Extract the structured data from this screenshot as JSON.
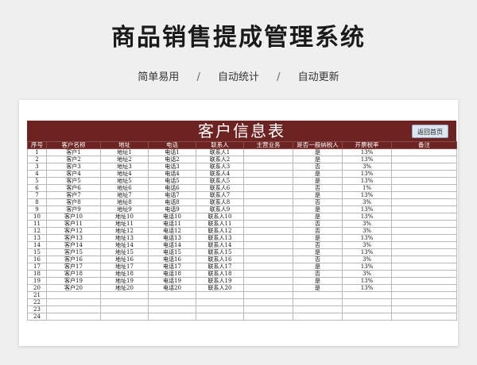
{
  "hero": {
    "title": "商品销售提成管理系统",
    "features": [
      "简单易用",
      "自动统计",
      "自动更新"
    ],
    "separator": "/"
  },
  "sheet": {
    "title": "客户信息表",
    "home_button": "返回首页",
    "columns": [
      "序号",
      "客户名称",
      "地址",
      "电话",
      "联系人",
      "主营业务",
      "是否一般纳税人",
      "开票税率",
      "备注"
    ],
    "rows": [
      [
        "1",
        "客户1",
        "地址1",
        "电话1",
        "联系人1",
        "",
        "是",
        "13%",
        ""
      ],
      [
        "2",
        "客户2",
        "地址2",
        "电话2",
        "联系人2",
        "",
        "是",
        "13%",
        ""
      ],
      [
        "3",
        "客户3",
        "地址3",
        "电话3",
        "联系人3",
        "",
        "否",
        "3%",
        ""
      ],
      [
        "4",
        "客户4",
        "地址4",
        "电话4",
        "联系人4",
        "",
        "是",
        "13%",
        ""
      ],
      [
        "5",
        "客户5",
        "地址5",
        "电话5",
        "联系人5",
        "",
        "是",
        "13%",
        ""
      ],
      [
        "6",
        "客户6",
        "地址6",
        "电话6",
        "联系人6",
        "",
        "否",
        "1%",
        ""
      ],
      [
        "7",
        "客户7",
        "地址7",
        "电话7",
        "联系人7",
        "",
        "是",
        "13%",
        ""
      ],
      [
        "8",
        "客户8",
        "地址8",
        "电话8",
        "联系人8",
        "",
        "否",
        "3%",
        ""
      ],
      [
        "9",
        "客户9",
        "地址9",
        "电话9",
        "联系人9",
        "",
        "是",
        "13%",
        ""
      ],
      [
        "10",
        "客户10",
        "地址10",
        "电话10",
        "联系人10",
        "",
        "是",
        "13%",
        ""
      ],
      [
        "11",
        "客户11",
        "地址11",
        "电话11",
        "联系人11",
        "",
        "否",
        "3%",
        ""
      ],
      [
        "12",
        "客户12",
        "地址12",
        "电话12",
        "联系人12",
        "",
        "否",
        "3%",
        ""
      ],
      [
        "13",
        "客户13",
        "地址13",
        "电话13",
        "联系人13",
        "",
        "是",
        "13%",
        ""
      ],
      [
        "14",
        "客户14",
        "地址14",
        "电话14",
        "联系人14",
        "",
        "否",
        "3%",
        ""
      ],
      [
        "15",
        "客户15",
        "地址15",
        "电话15",
        "联系人15",
        "",
        "是",
        "13%",
        ""
      ],
      [
        "16",
        "客户16",
        "地址16",
        "电话16",
        "联系人16",
        "",
        "否",
        "3%",
        ""
      ],
      [
        "17",
        "客户17",
        "地址17",
        "电话17",
        "联系人17",
        "",
        "是",
        "13%",
        ""
      ],
      [
        "18",
        "客户18",
        "地址18",
        "电话18",
        "联系人18",
        "",
        "否",
        "3%",
        ""
      ],
      [
        "19",
        "客户19",
        "地址19",
        "电话19",
        "联系人19",
        "",
        "是",
        "13%",
        ""
      ],
      [
        "20",
        "客户20",
        "地址20",
        "电话20",
        "联系人20",
        "",
        "是",
        "13%",
        ""
      ],
      [
        "21",
        "",
        "",
        "",
        "",
        "",
        "",
        "",
        ""
      ],
      [
        "22",
        "",
        "",
        "",
        "",
        "",
        "",
        "",
        ""
      ],
      [
        "23",
        "",
        "",
        "",
        "",
        "",
        "",
        "",
        ""
      ],
      [
        "24",
        "",
        "",
        "",
        "",
        "",
        "",
        "",
        ""
      ]
    ]
  },
  "colors": {
    "header_bg": "#6e2323",
    "button_bg": "#dde6f0"
  }
}
